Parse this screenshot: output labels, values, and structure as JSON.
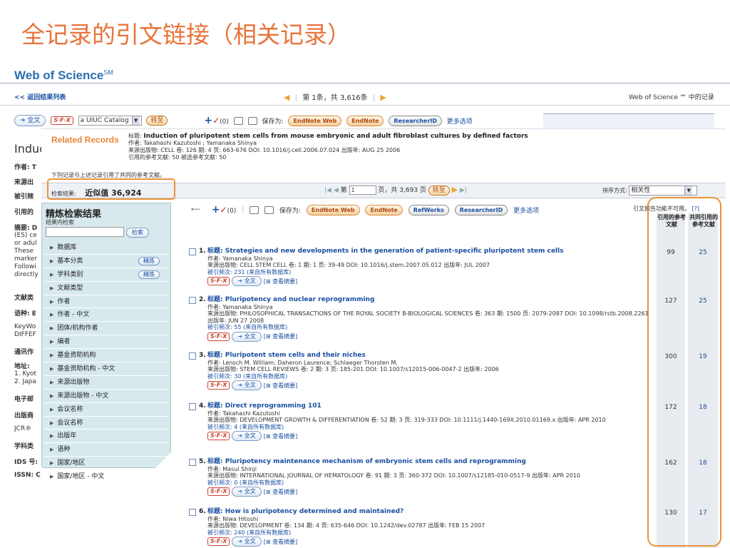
{
  "slide_title": "全记录的引文链接（相关记录）",
  "app": {
    "logo_text": "Web of Science",
    "logo_sup": "SM"
  },
  "nav": {
    "back_link": "<< 返回结果列表",
    "pager_text": "第 1条，共 3,616条",
    "wos_record_text": "Web of Science ℠ 中的记录"
  },
  "toolbar1": {
    "fulltext": "全文",
    "sfx": "S·F·X",
    "catalog_value": "a UIUC Catalog",
    "go": "转至",
    "marked_count": "(0)",
    "save_to": "保存为:",
    "endnote_web": "EndNote Web",
    "endnote": "EndNote",
    "researcherid": "ResearcherID",
    "more_options": "更多选项"
  },
  "background": {
    "title_fragment": "Induc",
    "lines": [
      "作者: T",
      "来源出",
      "被引频",
      "引用的",
      "摘要: D",
      "(ES) ce",
      "or adul",
      "These",
      "marker",
      "Followi",
      "directly",
      "文献类",
      "语种: E",
      "KeyWo",
      "DIFFEF",
      "通讯作",
      "地址:",
      "1. Kyot",
      "2. Japa",
      "电子邮",
      "出版商",
      "JCR® ",
      "学科类",
      "IDS 号:",
      "ISSN: C"
    ]
  },
  "related": {
    "heading": "Related Records",
    "title_label": "标题:",
    "title": "Induction of pluripotent stem cells from mouse embryonic and adult fibroblast cultures by defined factors",
    "authors": "作者: Takahashi Kazutoshi ; Yamanaka Shinya",
    "source": "来源出版物: CELL 卷: 126 期: 4 页: 663-676 DOI: 10.1016/j.cell.2006.07.024 出版年: AUG 25 2006",
    "cited_refs": "引用的参考文献: 50 被选参考文献: 50",
    "note": "下列记录与上述记录引用了共同的参考文献。"
  },
  "results_bar": {
    "label": "检索结果:",
    "approx": "近似值 36,924",
    "page_prefix": "第",
    "page_value": "1",
    "page_suffix": "页，共 3,693 页",
    "go": "转至",
    "sort_label": "排序方式:",
    "sort_value": "相关性"
  },
  "refine": {
    "title": "精炼检索结果",
    "subtitle": "结果内检索",
    "search_btn": "检索",
    "refine_btn": "精炼",
    "items": [
      "数据库",
      "基本分类",
      "学科类别",
      "文献类型",
      "作者",
      "作者 - 中文",
      "团体/机构作者",
      "编者",
      "基金资助机构",
      "基金资助机构 - 中文",
      "来源出版物",
      "来源出版物 - 中文",
      "会议名称",
      "会议名称",
      "出版年",
      "语种",
      "国家/地区",
      "国家/地区 - 中文"
    ]
  },
  "toolbar2": {
    "marked_count": "(0)",
    "save_to": "保存为:",
    "endnote_web": "EndNote Web",
    "endnote": "EndNote",
    "refworks": "RefWorks",
    "researcherid": "ResearcherID",
    "more_options": "更多选项",
    "unavailable": "引文报告功能不可用。",
    "help": "[?]"
  },
  "columns": {
    "cited_refs": "引用的参考文献",
    "shared_refs": "共同引用的参考文献"
  },
  "results": [
    {
      "num": "1.",
      "title": "标题: Strategies and new developments in the generation of patient-specific pluripotent stem cells",
      "authors": "作者: Yamanaka Shinya",
      "source": "来源出版物: CELL STEM CELL 卷: 1 期: 1 页: 39-49 DOI: 10.1016/j.stem.2007.05.012 出版年: JUL 2007",
      "cited": "被引频次: 231 (来自所有数据库)",
      "refs": "99",
      "shared": "25"
    },
    {
      "num": "2.",
      "title": "标题: Pluripotency and nuclear reprogramming",
      "authors": "作者: Yamanaka Shinya",
      "source": "来源出版物: PHILOSOPHICAL TRANSACTIONS OF THE ROYAL SOCIETY B-BIOLOGICAL SCIENCES 卷: 363 期: 1500 页: 2079-2087 DOI: 10.1098/rstb.2008.2261 出版年: JUN 27 2008",
      "cited": "被引频次: 55 (来自所有数据库)",
      "refs": "127",
      "shared": "25"
    },
    {
      "num": "3.",
      "title": "标题: Pluripotent stem cells and their niches",
      "authors": "作者: Lensch M. William; Daheron Laurence; Schlaeger Thorsten M.",
      "source": "来源出版物: STEM CELL REVIEWS 卷: 2 期: 3 页: 185-201 DOI: 10.1007/s12015-006-0047-2 出版年: 2006",
      "cited": "被引频次: 30 (来自所有数据库)",
      "refs": "300",
      "shared": "19"
    },
    {
      "num": "4.",
      "title": "标题: Direct reprogramming 101",
      "authors": "作者: Takahashi Kazutoshi",
      "source": "来源出版物: DEVELOPMENT GROWTH & DIFFERENTIATION 卷: 52 期: 3 页: 319-333 DOI: 10.1111/j.1440-169X.2010.01169.x 出版年: APR 2010",
      "cited": "被引频次: 4 (来自所有数据库)",
      "refs": "172",
      "shared": "18"
    },
    {
      "num": "5.",
      "title": "标题: Pluripotency maintenance mechanism of embryonic stem cells and reprogramming",
      "authors": "作者: Masui Shinji",
      "source": "来源出版物: INTERNATIONAL JOURNAL OF HEMATOLOGY 卷: 91 期: 3 页: 360-372 DOI: 10.1007/s12185-010-0517-9 出版年: APR 2010",
      "cited": "被引频次: 0 (来自所有数据库)",
      "refs": "162",
      "shared": "18"
    },
    {
      "num": "6.",
      "title": "标题: How is pluripotency determined and maintained?",
      "authors": "作者: Niwa Hitoshi",
      "source": "来源出版物: DEVELOPMENT 卷: 134 期: 4 页: 635-646 DOI: 10.1242/dev.02787 出版年: FEB 15 2007",
      "cited": "被引频次: 240 (来自所有数据库)",
      "refs": "130",
      "shared": "17"
    }
  ],
  "result_links": {
    "sfx": "S·F·X",
    "fulltext": "全文",
    "abstract": "[⊞ 查看摘要]"
  },
  "colors": {
    "accent": "#e8743b",
    "link": "#1a4fa0",
    "highlight": "#e8943a",
    "panel": "#d7e9ec"
  }
}
